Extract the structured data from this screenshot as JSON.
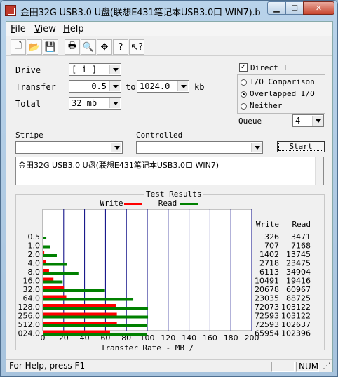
{
  "window": {
    "title": "金田32G USB3.0 U盘(联想E431笔记本USB3.0口 WIN7).bmk"
  },
  "menu": [
    "File",
    "View",
    "Help"
  ],
  "toolbar_icons": [
    "new-icon",
    "open-icon",
    "save-icon",
    "print-icon",
    "print-preview-icon",
    "move-icon",
    "help-icon",
    "context-help-icon"
  ],
  "form": {
    "drive_label": "Drive",
    "drive_value": "[-i-]",
    "transfer_label": "Transfer",
    "transfer_from": "0.5",
    "transfer_to_word": "to",
    "transfer_to": "1024.0",
    "transfer_unit": "kb",
    "total_label": "Total",
    "total_value": "32 mb",
    "stripe_label": "Stripe",
    "controlled_label": "Controlled",
    "direct_io_label": "Direct I",
    "direct_io_checked": true,
    "io_comparison_label": "I/O Comparison",
    "overlapped_label": "Overlapped I/O",
    "neither_label": "Neither",
    "selected_option": "overlapped",
    "queue_label": "Queue",
    "queue_value": "4",
    "start_label": "Start",
    "description": "金田32G USB3.0 U盘(联想E431笔记本USB3.0口 WIN7)"
  },
  "results": {
    "title": "Test Results",
    "write_col": "Write",
    "read_col": "Read"
  },
  "colors": {
    "write": "#ff0000",
    "read": "#008000"
  },
  "chart_data": {
    "type": "bar",
    "orientation": "horizontal",
    "categories": [
      "0.5",
      "1.0",
      "2.0",
      "4.0",
      "8.0",
      "16.0",
      "32.0",
      "64.0",
      "128.0",
      "256.0",
      "512.0",
      "024.0"
    ],
    "series": [
      {
        "name": "Write",
        "values": [
          326,
          707,
          1402,
          2718,
          6113,
          10491,
          20678,
          23035,
          72073,
          72593,
          72593,
          65954
        ]
      },
      {
        "name": "Read",
        "values": [
          3471,
          7168,
          13745,
          23475,
          34904,
          19416,
          60967,
          88725,
          103122,
          103122,
          102637,
          102396
        ]
      }
    ],
    "plotted_values_mb": {
      "write": [
        0.3,
        0.7,
        1.4,
        2.7,
        6.0,
        10.2,
        20.2,
        22.5,
        70.4,
        70.9,
        70.9,
        64.4
      ],
      "read": [
        3.4,
        7.0,
        13.4,
        22.9,
        34.1,
        19.0,
        59.5,
        86.6,
        100.7,
        100.7,
        100.2,
        100.0
      ]
    },
    "xlabel": "Transfer Rate - MB /",
    "x_ticks": [
      "0",
      "20",
      "40",
      "60",
      "80",
      "100",
      "120",
      "140",
      "160",
      "180",
      "200"
    ],
    "xlim": [
      0,
      200
    ],
    "legend": [
      "Write",
      "Read"
    ],
    "legend_placement": "top-center",
    "grid": true
  },
  "status": {
    "help_text": "For Help, press F1",
    "num_text": "NUM"
  }
}
